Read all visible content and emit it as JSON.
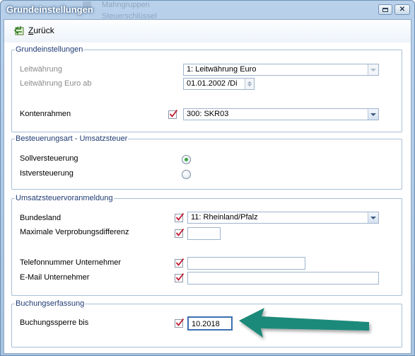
{
  "window": {
    "title": "Grundeinstellungen",
    "background_items": [
      "Mahngruppen",
      "Steuerschlüssel"
    ]
  },
  "toolbar": {
    "back_label": "Zurück",
    "back_icon": "back-arrow-icon"
  },
  "grundeinstellungen": {
    "title": "Grundeinstellungen",
    "leitwaehrung_label": "Leitwährung",
    "leitwaehrung_value": "1: Leitwährung Euro",
    "leitwaehrung_euro_ab_label": "Leitwährung Euro ab",
    "leitwaehrung_euro_ab_value": "01.01.2002 /Di",
    "kontenrahmen_label": "Kontenrahmen",
    "kontenrahmen_value": "300: SKR03"
  },
  "besteuerungsart": {
    "title": "Besteuerungsart - Umsatzsteuer",
    "options": [
      {
        "label": "Sollversteuerung",
        "selected": true
      },
      {
        "label": "Istversteuerung",
        "selected": false
      }
    ]
  },
  "umsatzsteuervoranmeldung": {
    "title": "Umsatzsteuervoranmeldung",
    "bundesland_label": "Bundesland",
    "bundesland_value": "11: Rheinland/Pfalz",
    "verprobungsdifferenz_label": "Maximale Verprobungsdifferenz",
    "verprobungsdifferenz_value": "",
    "telefon_label": "Telefonnummer Unternehmer",
    "telefon_value": "",
    "email_label": "E-Mail Unternehmer",
    "email_value": ""
  },
  "buchungserfassung": {
    "title": "Buchungserfassung",
    "sperre_label": "Buchungssperre bis",
    "sperre_value": "10.2018"
  },
  "colors": {
    "group_title": "#1f3c74",
    "annotation_arrow": "#1f8a7a",
    "radio_selected": "#3aa43e"
  }
}
